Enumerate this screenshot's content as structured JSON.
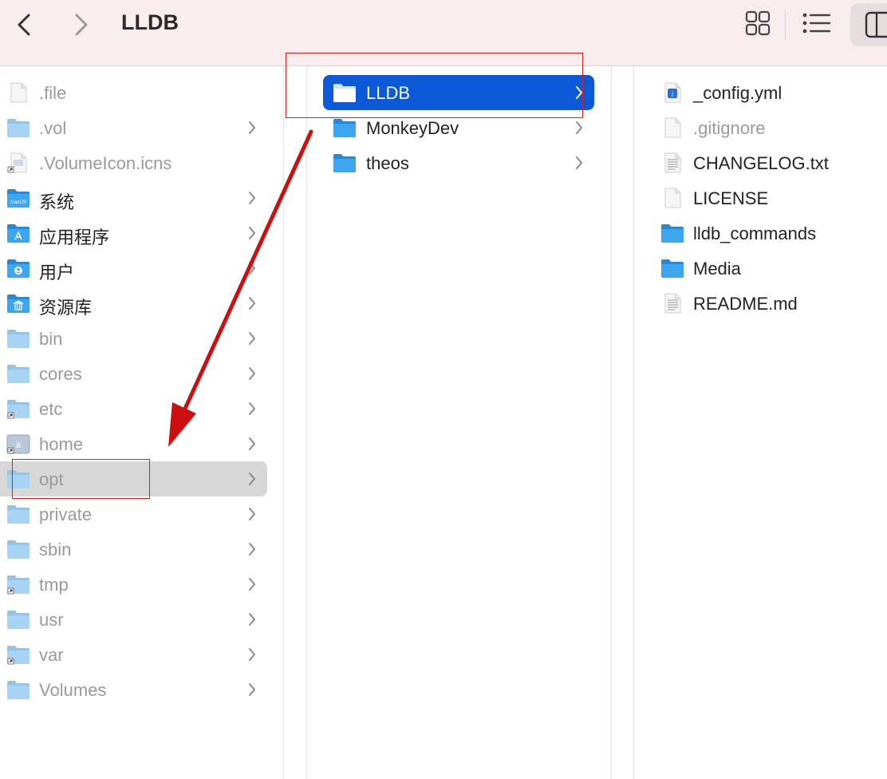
{
  "window": {
    "title": "LLDB"
  },
  "toolbar": {
    "back_icon": "chevron-left-icon",
    "forward_icon": "chevron-right-icon",
    "views": [
      "grid-view-icon",
      "list-view-icon",
      "column-view-icon"
    ]
  },
  "columns": {
    "root": {
      "items": [
        {
          "name": ".file",
          "type": "file",
          "dim": true,
          "folder": false
        },
        {
          "name": ".vol",
          "type": "folder",
          "dim": true,
          "folder": true
        },
        {
          "name": ".VolumeIcon.icns",
          "type": "alias-file",
          "dim": true,
          "folder": false
        },
        {
          "name": "系统",
          "type": "macos-folder",
          "dim": false,
          "folder": true
        },
        {
          "name": "应用程序",
          "type": "apps-folder",
          "dim": false,
          "folder": true
        },
        {
          "name": "用户",
          "type": "users-folder",
          "dim": false,
          "folder": true
        },
        {
          "name": "资源库",
          "type": "library-folder",
          "dim": false,
          "folder": true
        },
        {
          "name": "bin",
          "type": "folder",
          "dim": true,
          "folder": true
        },
        {
          "name": "cores",
          "type": "folder",
          "dim": true,
          "folder": true
        },
        {
          "name": "etc",
          "type": "alias-folder",
          "dim": true,
          "folder": true
        },
        {
          "name": "home",
          "type": "home-alias",
          "dim": true,
          "folder": true
        },
        {
          "name": "opt",
          "type": "folder",
          "dim": true,
          "folder": true,
          "selected": true
        },
        {
          "name": "private",
          "type": "folder",
          "dim": true,
          "folder": true
        },
        {
          "name": "sbin",
          "type": "folder",
          "dim": true,
          "folder": true
        },
        {
          "name": "tmp",
          "type": "alias-folder",
          "dim": true,
          "folder": true
        },
        {
          "name": "usr",
          "type": "folder",
          "dim": true,
          "folder": true
        },
        {
          "name": "var",
          "type": "alias-folder",
          "dim": true,
          "folder": true
        },
        {
          "name": "Volumes",
          "type": "folder",
          "dim": true,
          "folder": true
        }
      ]
    },
    "opt": {
      "items": [
        {
          "name": "LLDB",
          "selected": true
        },
        {
          "name": "MonkeyDev"
        },
        {
          "name": "theos"
        }
      ]
    },
    "lldb": {
      "items": [
        {
          "name": "_config.yml",
          "type": "yml-file",
          "dim": false
        },
        {
          "name": ".gitignore",
          "type": "file",
          "dim": true
        },
        {
          "name": "CHANGELOG.txt",
          "type": "text-file",
          "dim": false
        },
        {
          "name": "LICENSE",
          "type": "file",
          "dim": false
        },
        {
          "name": "lldb_commands",
          "type": "folder",
          "dim": false
        },
        {
          "name": "Media",
          "type": "folder",
          "dim": false
        },
        {
          "name": "README.md",
          "type": "text-file",
          "dim": false
        }
      ]
    }
  },
  "colors": {
    "selection_blue": "#0b59d6",
    "selection_gray": "#d7d7d7",
    "annotation_red": "#d32020",
    "folder_blue": "#3ea6ef"
  }
}
